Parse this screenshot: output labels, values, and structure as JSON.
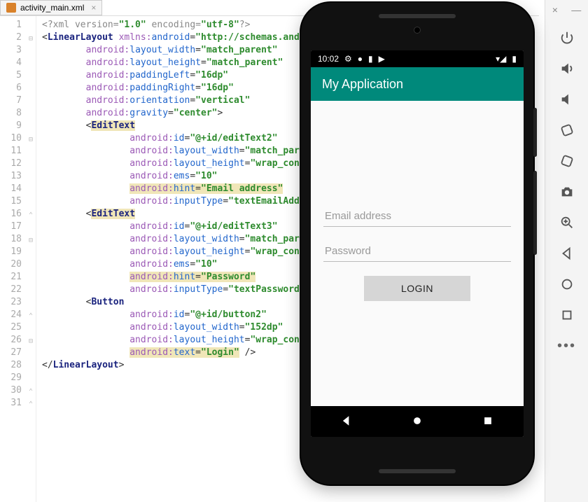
{
  "editor_tab": {
    "filename": "activity_main.xml"
  },
  "line_count": 31,
  "code_lines": [
    {
      "indent": 0,
      "segments": [
        {
          "t": "pi",
          "v": "<?xml version="
        },
        {
          "t": "val",
          "v": "\"1.0\""
        },
        {
          "t": "pi",
          "v": " encoding="
        },
        {
          "t": "val",
          "v": "\"utf-8\""
        },
        {
          "t": "pi",
          "v": "?>"
        }
      ]
    },
    {
      "indent": 0,
      "fold": true,
      "segments": [
        {
          "t": "punc",
          "v": "<"
        },
        {
          "t": "tag",
          "v": "LinearLayout"
        },
        {
          "t": "punc",
          "v": " "
        },
        {
          "t": "ns",
          "v": "xmlns:"
        },
        {
          "t": "attr",
          "v": "android"
        },
        {
          "t": "punc",
          "v": "="
        },
        {
          "t": "val",
          "v": "\"http://schemas.and"
        }
      ]
    },
    {
      "indent": 2,
      "segments": [
        {
          "t": "ns",
          "v": "android:"
        },
        {
          "t": "attr",
          "v": "layout_width"
        },
        {
          "t": "punc",
          "v": "="
        },
        {
          "t": "val",
          "v": "\"match_parent\""
        }
      ]
    },
    {
      "indent": 2,
      "segments": [
        {
          "t": "ns",
          "v": "android:"
        },
        {
          "t": "attr",
          "v": "layout_height"
        },
        {
          "t": "punc",
          "v": "="
        },
        {
          "t": "val",
          "v": "\"match_parent\""
        }
      ]
    },
    {
      "indent": 2,
      "segments": [
        {
          "t": "ns",
          "v": "android:"
        },
        {
          "t": "attr",
          "v": "paddingLeft"
        },
        {
          "t": "punc",
          "v": "="
        },
        {
          "t": "val",
          "v": "\"16dp\""
        }
      ]
    },
    {
      "indent": 2,
      "segments": [
        {
          "t": "ns",
          "v": "android:"
        },
        {
          "t": "attr",
          "v": "paddingRight"
        },
        {
          "t": "punc",
          "v": "="
        },
        {
          "t": "val",
          "v": "\"16dp\""
        }
      ]
    },
    {
      "indent": 2,
      "segments": [
        {
          "t": "ns",
          "v": "android:"
        },
        {
          "t": "attr",
          "v": "orientation"
        },
        {
          "t": "punc",
          "v": "="
        },
        {
          "t": "val",
          "v": "\"vertical\""
        }
      ]
    },
    {
      "indent": 2,
      "segments": [
        {
          "t": "ns",
          "v": "android:"
        },
        {
          "t": "attr",
          "v": "gravity"
        },
        {
          "t": "punc",
          "v": "="
        },
        {
          "t": "val",
          "v": "\"center\""
        },
        {
          "t": "punc",
          "v": ">"
        }
      ]
    },
    {
      "indent": 0,
      "segments": []
    },
    {
      "indent": 2,
      "fold": true,
      "segments": [
        {
          "t": "punc",
          "v": "<"
        },
        {
          "t": "tag",
          "hl": true,
          "v": "EditText"
        }
      ]
    },
    {
      "indent": 4,
      "segments": [
        {
          "t": "ns",
          "v": "android:"
        },
        {
          "t": "attr",
          "v": "id"
        },
        {
          "t": "punc",
          "v": "="
        },
        {
          "t": "val",
          "v": "\"@+id/editText2\""
        }
      ]
    },
    {
      "indent": 4,
      "segments": [
        {
          "t": "ns",
          "v": "android:"
        },
        {
          "t": "attr",
          "v": "layout_width"
        },
        {
          "t": "punc",
          "v": "="
        },
        {
          "t": "val",
          "v": "\"match_parent\""
        }
      ]
    },
    {
      "indent": 4,
      "segments": [
        {
          "t": "ns",
          "v": "android:"
        },
        {
          "t": "attr",
          "v": "layout_height"
        },
        {
          "t": "punc",
          "v": "="
        },
        {
          "t": "val",
          "v": "\"wrap_content\""
        }
      ]
    },
    {
      "indent": 4,
      "segments": [
        {
          "t": "ns",
          "v": "android:"
        },
        {
          "t": "attr",
          "v": "ems"
        },
        {
          "t": "punc",
          "v": "="
        },
        {
          "t": "val",
          "v": "\"10\""
        }
      ]
    },
    {
      "indent": 4,
      "segments": [
        {
          "t": "ns",
          "hl": true,
          "v": "android:"
        },
        {
          "t": "attr",
          "hl": true,
          "v": "hint"
        },
        {
          "t": "punc",
          "hl": true,
          "v": "="
        },
        {
          "t": "val",
          "hl": true,
          "v": "\"Email address\""
        }
      ]
    },
    {
      "indent": 4,
      "foldend": true,
      "segments": [
        {
          "t": "ns",
          "v": "android:"
        },
        {
          "t": "attr",
          "v": "inputType"
        },
        {
          "t": "punc",
          "v": "="
        },
        {
          "t": "val",
          "v": "\"textEmailAddress\""
        },
        {
          "t": "punc",
          "v": " />"
        }
      ]
    },
    {
      "indent": 0,
      "segments": []
    },
    {
      "indent": 2,
      "fold": true,
      "segments": [
        {
          "t": "punc",
          "v": "<"
        },
        {
          "t": "tag",
          "hl": true,
          "v": "EditText"
        }
      ]
    },
    {
      "indent": 4,
      "segments": [
        {
          "t": "ns",
          "v": "android:"
        },
        {
          "t": "attr",
          "v": "id"
        },
        {
          "t": "punc",
          "v": "="
        },
        {
          "t": "val",
          "v": "\"@+id/editText3\""
        }
      ]
    },
    {
      "indent": 4,
      "segments": [
        {
          "t": "ns",
          "v": "android:"
        },
        {
          "t": "attr",
          "v": "layout_width"
        },
        {
          "t": "punc",
          "v": "="
        },
        {
          "t": "val",
          "v": "\"match_parent\""
        }
      ]
    },
    {
      "indent": 4,
      "segments": [
        {
          "t": "ns",
          "v": "android:"
        },
        {
          "t": "attr",
          "v": "layout_height"
        },
        {
          "t": "punc",
          "v": "="
        },
        {
          "t": "val",
          "v": "\"wrap_content\""
        }
      ]
    },
    {
      "indent": 4,
      "segments": [
        {
          "t": "ns",
          "v": "android:"
        },
        {
          "t": "attr",
          "v": "ems"
        },
        {
          "t": "punc",
          "v": "="
        },
        {
          "t": "val",
          "v": "\"10\""
        }
      ]
    },
    {
      "indent": 4,
      "segments": [
        {
          "t": "ns",
          "hl": true,
          "v": "android:"
        },
        {
          "t": "attr",
          "hl": true,
          "v": "hint"
        },
        {
          "t": "punc",
          "hl": true,
          "v": "="
        },
        {
          "t": "val",
          "hl": true,
          "v": "\"Password\""
        }
      ]
    },
    {
      "indent": 4,
      "foldend": true,
      "segments": [
        {
          "t": "ns",
          "v": "android:"
        },
        {
          "t": "attr",
          "v": "inputType"
        },
        {
          "t": "punc",
          "v": "="
        },
        {
          "t": "val",
          "v": "\"textPassword\""
        },
        {
          "t": "punc",
          "v": " />"
        }
      ]
    },
    {
      "indent": 0,
      "segments": []
    },
    {
      "indent": 2,
      "fold": true,
      "segments": [
        {
          "t": "punc",
          "v": "<"
        },
        {
          "t": "tag",
          "v": "Button"
        }
      ]
    },
    {
      "indent": 4,
      "segments": [
        {
          "t": "ns",
          "v": "android:"
        },
        {
          "t": "attr",
          "v": "id"
        },
        {
          "t": "punc",
          "v": "="
        },
        {
          "t": "val",
          "v": "\"@+id/button2\""
        }
      ]
    },
    {
      "indent": 4,
      "segments": [
        {
          "t": "ns",
          "v": "android:"
        },
        {
          "t": "attr",
          "v": "layout_width"
        },
        {
          "t": "punc",
          "v": "="
        },
        {
          "t": "val",
          "v": "\"152dp\""
        }
      ]
    },
    {
      "indent": 4,
      "segments": [
        {
          "t": "ns",
          "v": "android:"
        },
        {
          "t": "attr",
          "v": "layout_height"
        },
        {
          "t": "punc",
          "v": "="
        },
        {
          "t": "val",
          "v": "\"wrap_content\""
        }
      ]
    },
    {
      "indent": 4,
      "foldend": true,
      "segments": [
        {
          "t": "ns",
          "hl": true,
          "v": "android:"
        },
        {
          "t": "attr",
          "hl": true,
          "v": "text"
        },
        {
          "t": "punc",
          "hl": true,
          "v": "="
        },
        {
          "t": "val",
          "hl": true,
          "v": "\"Login\""
        },
        {
          "t": "punc",
          "v": " />"
        }
      ]
    },
    {
      "indent": 0,
      "foldend": true,
      "segments": [
        {
          "t": "punc",
          "v": "</"
        },
        {
          "t": "tag",
          "v": "LinearLayout"
        },
        {
          "t": "punc",
          "v": ">"
        }
      ]
    }
  ],
  "emulator": {
    "status_time": "10:02",
    "app_title": "My Application",
    "email_placeholder": "Email address",
    "password_placeholder": "Password",
    "login_button": "LOGIN"
  },
  "toolbar_icons": [
    "power",
    "volume-up",
    "volume-down",
    "rotate-left",
    "rotate-right",
    "camera",
    "zoom",
    "back",
    "home",
    "overview",
    "more"
  ],
  "colors": {
    "teal": "#00897b",
    "highlight": "#f0e6b8"
  }
}
